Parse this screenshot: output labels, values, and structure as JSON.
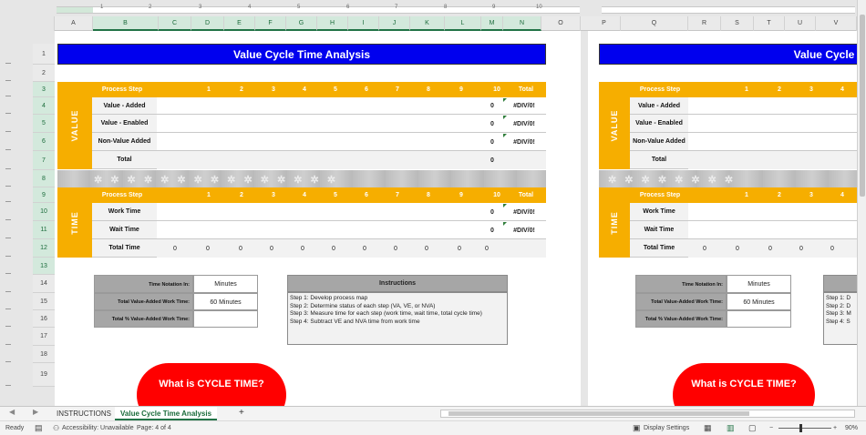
{
  "columns_left": [
    "A",
    "B",
    "C",
    "D",
    "E",
    "F",
    "G",
    "H",
    "I",
    "J",
    "K",
    "L",
    "M",
    "N",
    "O"
  ],
  "columns_right": [
    "P",
    "Q",
    "R",
    "S",
    "T",
    "U",
    "V"
  ],
  "rows": [
    "1",
    "2",
    "3",
    "4",
    "5",
    "6",
    "7",
    "8",
    "9",
    "10",
    "11",
    "12",
    "13",
    "14",
    "15",
    "16",
    "17",
    "18",
    "19"
  ],
  "ruler_numbers": [
    "1",
    "2",
    "3",
    "4",
    "5",
    "6",
    "7",
    "8",
    "9",
    "10"
  ],
  "sheet": {
    "title": "Value Cycle Time Analysis",
    "title_partial": "Value Cycle T",
    "value_label": "VALUE",
    "time_label": "TIME",
    "process_step": "Process Step",
    "steps": [
      "1",
      "2",
      "3",
      "4",
      "5",
      "6",
      "7",
      "8",
      "9",
      "10"
    ],
    "total_hdr": "Total",
    "pct_hdr": "% Total",
    "value_rows": [
      {
        "label": "Value - Added",
        "total": "0",
        "pct": "#DIV/0!"
      },
      {
        "label": "Value - Enabled",
        "total": "0",
        "pct": "#DIV/0!"
      },
      {
        "label": "Non-Value Added",
        "total": "0",
        "pct": "#DIV/0!"
      },
      {
        "label": "Total",
        "total": "0",
        "pct": ""
      }
    ],
    "time_rows": [
      {
        "label": "Work Time",
        "total": "0",
        "pct": "#DIV/0!"
      },
      {
        "label": "Wait Time",
        "total": "0",
        "pct": "#DIV/0!"
      }
    ],
    "total_time": {
      "label": "Total Time",
      "values": [
        "0",
        "0",
        "0",
        "0",
        "0",
        "0",
        "0",
        "0",
        "0",
        "0",
        "0"
      ]
    },
    "notation": {
      "label1": "Time Notation In:",
      "value1": "Minutes",
      "label2": "Total Value-Added Work Time:",
      "value2": "60 Minutes",
      "label3": "Total % Value-Added Work Time:",
      "value3": ""
    },
    "instructions": {
      "title": "Instructions",
      "lines": [
        "Step 1:  Develop process map",
        "Step 2:  Determine status of each step (VA, VE, or NVA)",
        "Step 3:  Measure time for each step (work time, wait time, total cycle time)",
        "Step 4:  Subtract VE and NVA time from work time"
      ],
      "lines_partial": [
        "Step 1:  D",
        "Step 2:  D",
        "Step 3:  M",
        "Step 4:  S"
      ]
    },
    "cta": "What is CYCLE TIME?"
  },
  "tabs": [
    "INSTRUCTIONS",
    "Value Cycle Time Analysis"
  ],
  "add_sheet": "+",
  "status": {
    "ready": "Ready",
    "accessibility": "Accessibility: Unavailable",
    "page": "Page: 4 of 4",
    "display": "Display Settings",
    "zoom": "90%",
    "zoom_minus": "−",
    "zoom_plus": "+"
  },
  "colors": {
    "banner": "#0000EE",
    "accent": "#F6AE00",
    "cta": "#FF0000",
    "excel_green": "#217346"
  }
}
